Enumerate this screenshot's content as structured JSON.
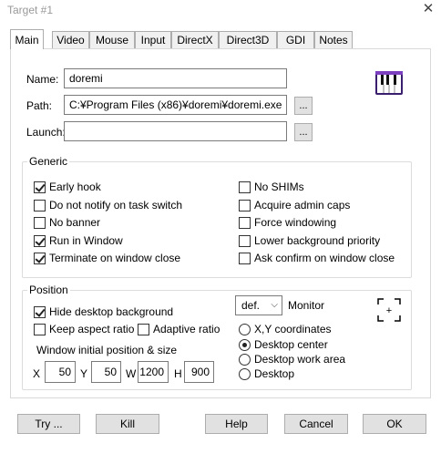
{
  "window": {
    "title": "Target #1"
  },
  "tabs": [
    "Main",
    "Video",
    "Mouse",
    "Input",
    "DirectX",
    "Direct3D",
    "GDI",
    "Notes"
  ],
  "fields": {
    "name_label": "Name:",
    "name_value": "doremi",
    "path_label": "Path:",
    "path_value": "C:¥Program Files (x86)¥doremi¥doremi.exe",
    "launch_label": "Launch:",
    "launch_value": "",
    "browse_label": "..."
  },
  "generic": {
    "title": "Generic",
    "left": [
      {
        "label": "Early hook",
        "checked": true
      },
      {
        "label": "Do not notify on task switch",
        "checked": false
      },
      {
        "label": "No banner",
        "checked": false
      },
      {
        "label": "Run in Window",
        "checked": true
      },
      {
        "label": "Terminate on window close",
        "checked": true
      }
    ],
    "right": [
      {
        "label": "No SHIMs",
        "checked": false
      },
      {
        "label": "Acquire admin caps",
        "checked": false
      },
      {
        "label": "Force windowing",
        "checked": false
      },
      {
        "label": "Lower background priority",
        "checked": false
      },
      {
        "label": "Ask confirm on window close",
        "checked": false
      }
    ]
  },
  "position": {
    "title": "Position",
    "hide_desktop": {
      "label": "Hide desktop background",
      "checked": true
    },
    "keep_aspect": {
      "label": "Keep aspect ratio",
      "checked": false
    },
    "adaptive": {
      "label": "Adaptive ratio",
      "checked": false
    },
    "monitor_select": "def.",
    "monitor_label": "Monitor",
    "radios": [
      {
        "label": "X,Y coordinates",
        "checked": false
      },
      {
        "label": "Desktop center",
        "checked": true
      },
      {
        "label": "Desktop work area",
        "checked": false
      },
      {
        "label": "Desktop",
        "checked": false
      }
    ],
    "initial_label": "Window initial position & size",
    "x_label": "X",
    "x_value": "50",
    "y_label": "Y",
    "y_value": "50",
    "w_label": "W",
    "w_value": "1200",
    "h_label": "H",
    "h_value": "900",
    "crosshair_glyph": "+"
  },
  "buttons": {
    "try": "Try ...",
    "kill": "Kill",
    "help": "Help",
    "cancel": "Cancel",
    "ok": "OK"
  },
  "icons": {
    "app_icon": "piano-icon",
    "close": "close-icon"
  }
}
